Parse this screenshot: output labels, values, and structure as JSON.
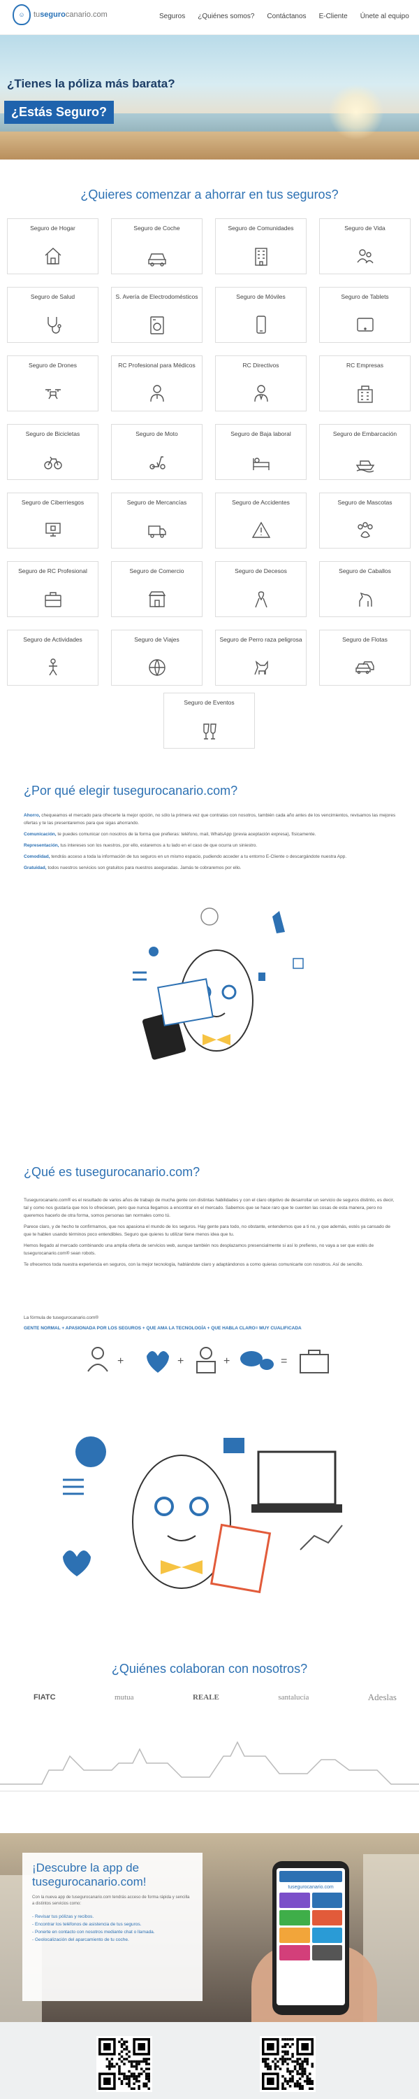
{
  "header": {
    "logo_prefix": "tu",
    "logo_brand": "seguro",
    "logo_suffix": "canario.com",
    "nav": [
      "Seguros",
      "¿Quiénes somos?",
      "Contáctanos",
      "E-Cliente",
      "Únete al equipo"
    ]
  },
  "hero": {
    "title": "¿Tienes la póliza más barata?",
    "cta": "¿Estás Seguro?",
    "slides": 12,
    "active_slide": 0
  },
  "insurance": {
    "title": "¿Quieres comenzar a ahorrar en tus seguros?",
    "items": [
      {
        "label": "Seguro de Hogar",
        "icon": "house-icon"
      },
      {
        "label": "Seguro de Coche",
        "icon": "car-icon"
      },
      {
        "label": "Seguro de Comunidades",
        "icon": "building-icon"
      },
      {
        "label": "Seguro de Vida",
        "icon": "people-icon"
      },
      {
        "label": "Seguro de Salud",
        "icon": "stethoscope-icon"
      },
      {
        "label": "S. Avería de Electrodomésticos",
        "icon": "appliance-icon"
      },
      {
        "label": "Seguro de Móviles",
        "icon": "mobile-icon"
      },
      {
        "label": "Seguro de Tablets",
        "icon": "tablet-icon"
      },
      {
        "label": "Seguro de Drones",
        "icon": "drone-icon"
      },
      {
        "label": "RC Profesional para Médicos",
        "icon": "doctor-icon"
      },
      {
        "label": "RC Directivos",
        "icon": "executive-icon"
      },
      {
        "label": "RC Empresas",
        "icon": "company-icon"
      },
      {
        "label": "Seguro de Bicicletas",
        "icon": "bicycle-icon"
      },
      {
        "label": "Seguro de Moto",
        "icon": "scooter-icon"
      },
      {
        "label": "Seguro de Baja laboral",
        "icon": "sick-leave-icon"
      },
      {
        "label": "Seguro de Embarcación",
        "icon": "boat-icon"
      },
      {
        "label": "Seguro de Ciberriesgos",
        "icon": "cyber-icon"
      },
      {
        "label": "Seguro de Mercancías",
        "icon": "truck-icon"
      },
      {
        "label": "Seguro de Accidentes",
        "icon": "warning-icon"
      },
      {
        "label": "Seguro de Mascotas",
        "icon": "paw-icon"
      },
      {
        "label": "Seguro de RC Profesional",
        "icon": "briefcase-icon"
      },
      {
        "label": "Seguro de Comercio",
        "icon": "shop-icon"
      },
      {
        "label": "Seguro de Decesos",
        "icon": "ribbon-icon"
      },
      {
        "label": "Seguro de Caballos",
        "icon": "horse-icon"
      },
      {
        "label": "Seguro de Actividades",
        "icon": "activities-icon"
      },
      {
        "label": "Seguro de Viajes",
        "icon": "globe-icon"
      },
      {
        "label": "Seguro de Perro raza peligrosa",
        "icon": "dog-icon"
      },
      {
        "label": "Seguro de Flotas",
        "icon": "fleet-icon"
      }
    ],
    "last_item": {
      "label": "Seguro de Eventos",
      "icon": "toast-icon"
    }
  },
  "why": {
    "title": "¿Por qué elegir tusegurocanario.com?",
    "paragraphs": [
      {
        "lead": "Ahorro,",
        "text": " chequeamos el mercado para ofrecerte la mejor opción, no sólo la primera vez que contratas con nosotros, también cada año antes de los vencimientos, revisamos las mejores ofertas y te las presentaremos para que sigas ahorrando."
      },
      {
        "lead": "Comunicación,",
        "text": " te puedes comunicar con nosotros de la forma que prefieras: teléfono, mail, WhatsApp (previa aceptación expresa), físicamente."
      },
      {
        "lead": "Representación,",
        "text": " tus intereses son los nuestros, por ello, estaremos a tu lado en el caso de que ocurra un siniestro."
      },
      {
        "lead": "Comodidad,",
        "text": " tendrás acceso a toda la información de tus seguros en un mismo espacio, pudiendo acceder a tu entorno E-Cliente o descargándote nuestra App."
      },
      {
        "lead": "Gratuidad,",
        "text": " todos nuestros servicios son gratuitos para nuestros aseguradas. Jamás te cobraremos por ello."
      }
    ]
  },
  "what": {
    "title": "¿Qué es tusegurocanario.com?",
    "paragraphs": [
      "Tusegurocanario.com® es el resultado de varios años de trabajo de mucha gente con distintas habilidades y con el claro objetivo de desarrollar un servicio de seguros distinto, es decir, tal y como nos gustaría que nos lo ofreciesen, pero que nunca llegamos a encontrar en el mercado. Sabemos que se hace raro que te cuenten las cosas de esta manera, pero no queremos hacerlo de otra forma, somos personas tan normales como tú.",
      "Parece claro, y de hecho te confirmamos, que nos apasiona el mundo de los seguros. Hay gente para todo, no obstante, entendemos que a ti no, y que además, estés ya cansado de que te hablen usando términos poco entendibles. Seguro que quieres tu utilizar tiene menos idea que tu.",
      "Hemos llegado al mercado combinando una amplia oferta de servicios web, aunque también nos desplazamos presencialmente si así lo prefieres, no vaya a ser que estés de tusegurocanario.com® sean robots.",
      "Te ofrecemos toda nuestra experiencia en seguros, con la mejor tecnología, hablándote claro y adaptándonos a como quieras comunicarte con nosotros. Así de sencillo."
    ],
    "formula_intro": "La fórmula de tusegurocanario.com®",
    "formula": "GENTE NORMAL + APASIONADA POR LOS SEGUROS + QUE AMA LA TECNOLOGÍA + QUE HABLA CLARO= MUY CUALIFICADA"
  },
  "partners": {
    "title": "¿Quiénes colaboran con nosotros?",
    "logos": [
      "FIATC",
      "mutua",
      "REALE",
      "santalucía",
      "Adeslas"
    ]
  },
  "app": {
    "title": "¡Descubre la app de tusegurocanario.com!",
    "desc": "Con la nueva app de tusegurocanario.com tendrás acceso de forma rápida y sencilla a distintos servicios como:",
    "items": [
      "- Revisar tus pólizas y recibos.",
      "- Encontrar los teléfonos de asistencia de tus seguros.",
      "- Ponerte en contacto con nosotros mediante chat o llamada.",
      "- Geolocalización del aparcamiento de tu coche."
    ],
    "phone_logo": "tusegurocanario.com"
  },
  "qr": {
    "count": 2
  },
  "colors": {
    "brand": "#2d71b3",
    "hero_cta": "#1f63ad"
  }
}
